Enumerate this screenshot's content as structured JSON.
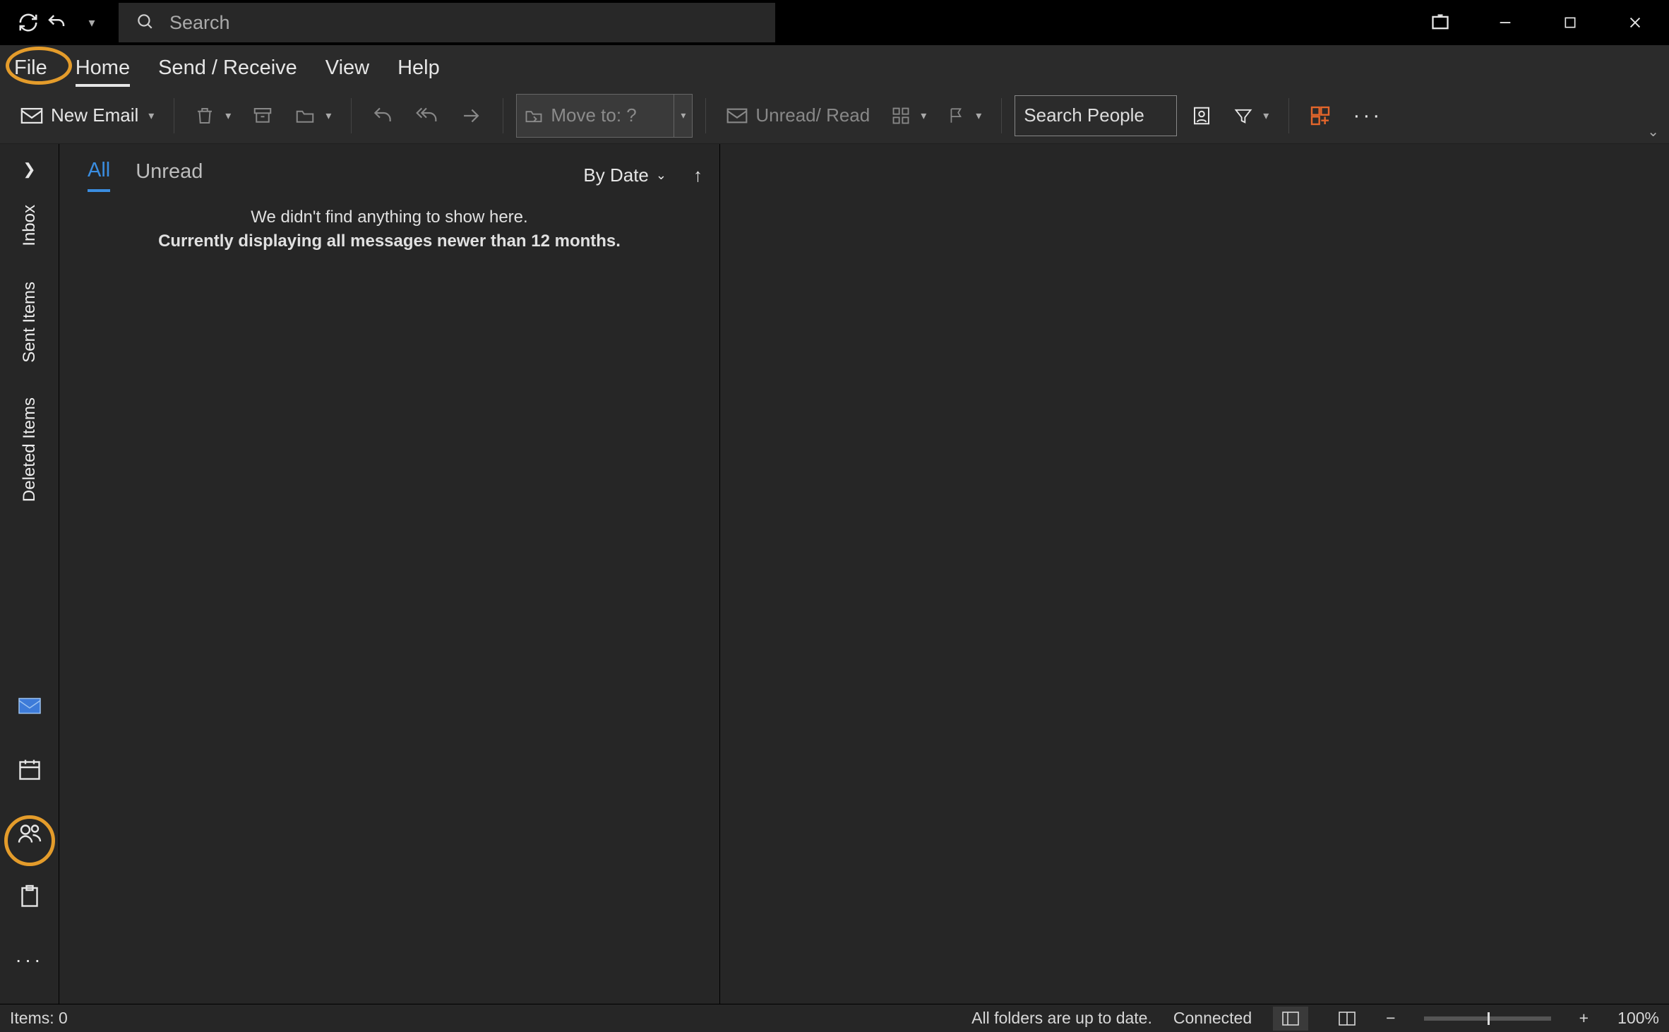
{
  "titlebar": {
    "search_placeholder": "Search"
  },
  "tabs": {
    "file": "File",
    "home": "Home",
    "sendreceive": "Send / Receive",
    "view": "View",
    "help": "Help"
  },
  "ribbon": {
    "new_email": "New Email",
    "move_to": "Move to: ?",
    "unread_read": "Unread/ Read",
    "search_people": "Search People"
  },
  "folders": {
    "inbox": "Inbox",
    "sent": "Sent Items",
    "deleted": "Deleted Items"
  },
  "msglist": {
    "all": "All",
    "unread": "Unread",
    "sort": "By Date",
    "empty1": "We didn't find anything to show here.",
    "empty2": "Currently displaying all messages newer than 12 months."
  },
  "status": {
    "items": "Items: 0",
    "sync": "All folders are up to date.",
    "conn": "Connected",
    "zoom": "100%"
  }
}
